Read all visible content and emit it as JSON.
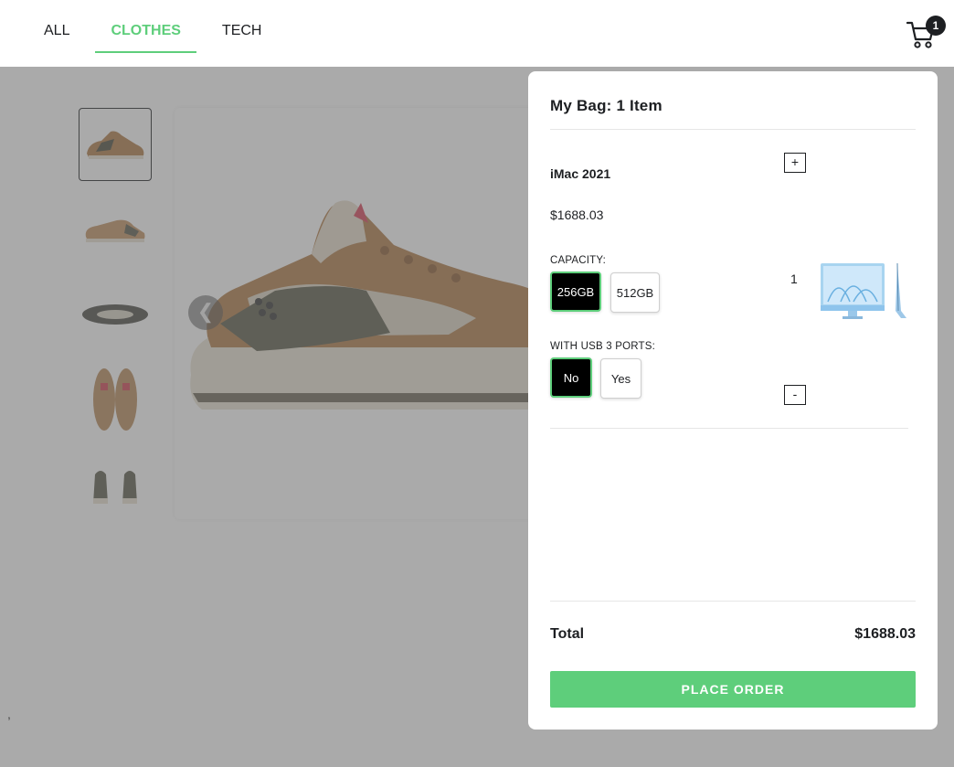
{
  "nav": {
    "items": [
      {
        "label": "ALL",
        "active": false
      },
      {
        "label": "CLOTHES",
        "active": true
      },
      {
        "label": "TECH",
        "active": false
      }
    ],
    "cart_count": "1"
  },
  "product_page": {
    "prev_arrow": "❮",
    "stray_text": ","
  },
  "cart": {
    "title": "My Bag: 1 Item",
    "items": [
      {
        "name": "iMac 2021",
        "price": "$1688.03",
        "quantity": "1",
        "increase_label": "+",
        "decrease_label": "-",
        "attributes": [
          {
            "label": "CAPACITY:",
            "options": [
              "256GB",
              "512GB"
            ],
            "selected": "256GB"
          },
          {
            "label": "WITH USB 3 PORTS:",
            "options": [
              "No",
              "Yes"
            ],
            "selected": "No"
          }
        ]
      }
    ],
    "total_label": "Total",
    "total_value": "$1688.03",
    "place_order_label": "PLACE ORDER"
  },
  "colors": {
    "accent": "#5ece7b",
    "text": "#1d1f22",
    "overlay": "#646464"
  },
  "icons": [
    "cart-icon",
    "chevron-left-icon"
  ]
}
